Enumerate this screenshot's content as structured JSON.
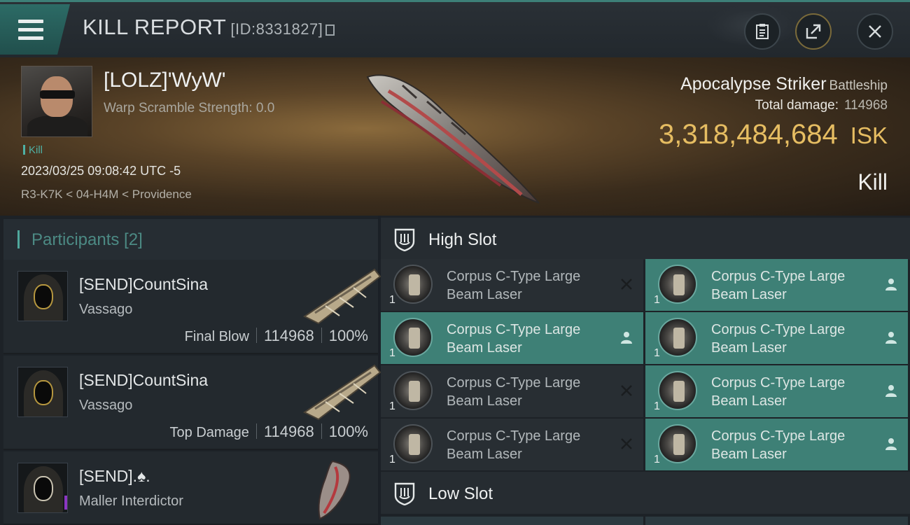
{
  "header": {
    "title": "KILL REPORT",
    "report_id": "[ID:8331827]"
  },
  "victim": {
    "name": "[LOLZ]'WyW'",
    "warp_scramble": "Warp Scramble Strength: 0.0",
    "tag": "Kill",
    "datetime": "2023/03/25 09:08:42 UTC -5",
    "location": "R3-K7K < 04-H4M < Providence",
    "ship_name": "Apocalypse Striker",
    "ship_class": "Battleship",
    "total_damage_label": "Total damage:",
    "total_damage": "114968",
    "isk_value": "3,318,484,684",
    "isk_unit": "ISK",
    "result": "Kill"
  },
  "participants": {
    "title": "Participants [2]",
    "rows": [
      {
        "name": "[SEND]CountSina",
        "ship": "Vassago",
        "label": "Final Blow",
        "damage": "114968",
        "percent": "100%"
      },
      {
        "name": "[SEND]CountSina",
        "ship": "Vassago",
        "label": "Top Damage",
        "damage": "114968",
        "percent": "100%"
      },
      {
        "name": "[SEND].♠.",
        "ship": "Maller Interdictor",
        "badge": "i"
      }
    ]
  },
  "slots": {
    "high_title": "High Slot",
    "low_title": "Low Slot",
    "high_modules": [
      {
        "line1": "Corpus C-Type Large",
        "line2": "Beam Laser",
        "qty": "1",
        "state": "destroyed"
      },
      {
        "line1": "Corpus C-Type Large",
        "line2": "Beam Laser",
        "qty": "1",
        "state": "dropped"
      },
      {
        "line1": "Corpus C-Type Large",
        "line2": "Beam Laser",
        "qty": "1",
        "state": "dropped"
      },
      {
        "line1": "Corpus C-Type Large",
        "line2": "Beam Laser",
        "qty": "1",
        "state": "dropped"
      },
      {
        "line1": "Corpus C-Type Large",
        "line2": "Beam Laser",
        "qty": "1",
        "state": "destroyed"
      },
      {
        "line1": "Corpus C-Type Large",
        "line2": "Beam Laser",
        "qty": "1",
        "state": "dropped"
      },
      {
        "line1": "Corpus C-Type Large",
        "line2": "Beam Laser",
        "qty": "1",
        "state": "destroyed"
      },
      {
        "line1": "Corpus C-Type Large",
        "line2": "Beam Laser",
        "qty": "1",
        "state": "dropped"
      }
    ]
  },
  "colors": {
    "accent_teal": "#3e8076",
    "isk_gold": "#e6bd62",
    "badge_purple": "#8b36c2"
  },
  "icons": [
    "menu-icon",
    "clipboard-icon",
    "share-icon",
    "close-icon",
    "copy-icon",
    "shield-slot-icon",
    "pilot-icon",
    "x-icon"
  ]
}
